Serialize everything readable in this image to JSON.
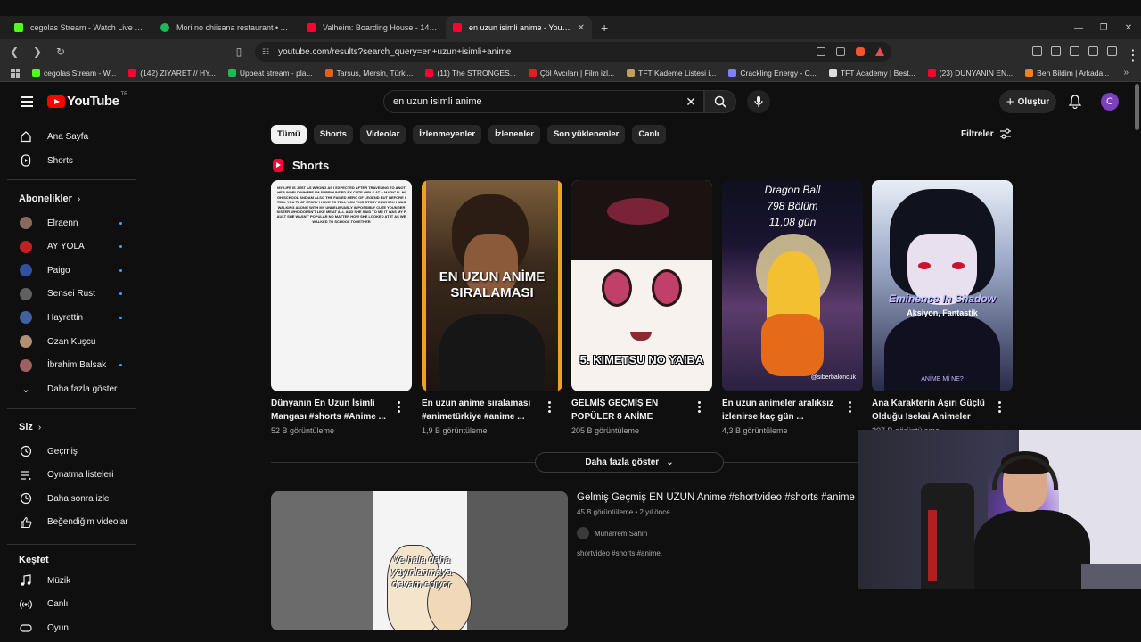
{
  "browser": {
    "tabs": [
      {
        "title": "cegolas Stream - Watch Live on Kick",
        "color": "#53fc18"
      },
      {
        "title": "Mori no chiisana restaurant • Aoi Te",
        "color": "#1db954"
      },
      {
        "title": "Valheim: Boarding House - 14 Player",
        "color": "#ff0033"
      },
      {
        "title": "en uzun isimli anime - YouTube",
        "color": "#ff0033",
        "active": true
      }
    ],
    "url": "youtube.com/results?search_query=en+uzun+isimli+anime",
    "bookmarks": [
      {
        "label": "cegolas Stream - W...",
        "color": "#53fc18"
      },
      {
        "label": "(142) ZİYARET // HY...",
        "color": "#ff0033"
      },
      {
        "label": "Upbeat stream - pla...",
        "color": "#1db954"
      },
      {
        "label": "Tarsus, Mersin, Türki...",
        "color": "#e06020"
      },
      {
        "label": "(11) The STRONGES...",
        "color": "#ff0033"
      },
      {
        "label": "Çöl Avcıları | Film izl...",
        "color": "#e02020"
      },
      {
        "label": "TFT Kademe Listesi i...",
        "color": "#c0a060"
      },
      {
        "label": "Crackling Energy - C...",
        "color": "#8080ff"
      },
      {
        "label": "TFT Academy | Best...",
        "color": "#dddddd"
      },
      {
        "label": "(23) DÜNYANIN EN...",
        "color": "#ff0033"
      },
      {
        "label": "Ben Bildim | Arkada...",
        "color": "#f08030"
      }
    ]
  },
  "youtube": {
    "logo_text": "YouTube",
    "region": "TR",
    "search_value": "en uzun isimli anime",
    "create_label": "Oluştur",
    "avatar_letter": "C",
    "sidebar": {
      "main": [
        {
          "label": "Ana Sayfa",
          "icon": "home-icon"
        },
        {
          "label": "Shorts",
          "icon": "shorts-icon"
        }
      ],
      "subscriptions_header": "Abonelikler",
      "subscriptions": [
        {
          "label": "Elraenn",
          "color": "#8a6a5a",
          "dot": true
        },
        {
          "label": "AY YOLA",
          "color": "#c02020",
          "dot": true
        },
        {
          "label": "Paigo",
          "color": "#3050a0",
          "dot": true
        },
        {
          "label": "Sensei Rust",
          "color": "#606060",
          "dot": true
        },
        {
          "label": "Hayrettin",
          "color": "#4060a0",
          "dot": true
        },
        {
          "label": "Ozan Kuşcu",
          "color": "#b09070",
          "dot": false
        },
        {
          "label": "İbrahim Balsak",
          "color": "#a06060",
          "dot": true
        }
      ],
      "show_more": "Daha fazla göster",
      "you_header": "Siz",
      "you": [
        {
          "label": "Geçmiş",
          "icon": "history-icon"
        },
        {
          "label": "Oynatma listeleri",
          "icon": "playlist-icon"
        },
        {
          "label": "Daha sonra izle",
          "icon": "clock-icon"
        },
        {
          "label": "Beğendiğim videolar",
          "icon": "thumbs-up-icon"
        }
      ],
      "explore_header": "Keşfet",
      "explore": [
        {
          "label": "Müzik",
          "icon": "music-icon"
        },
        {
          "label": "Canlı",
          "icon": "live-icon"
        },
        {
          "label": "Oyun",
          "icon": "game-icon"
        }
      ]
    },
    "chips": [
      "Tümü",
      "Shorts",
      "Videolar",
      "İzlenmeyenler",
      "İzlenenler",
      "Son yüklenenler",
      "Canlı"
    ],
    "filters_label": "Filtreler",
    "shorts_heading": "Shorts",
    "shorts": [
      {
        "title": "Dünyanın En Uzun İsimli Mangası #shorts #Anime ...",
        "views": "52 B görüntüleme"
      },
      {
        "title": "En uzun anime sıralaması #animetürkiye #anime ...",
        "views": "1,9 B görüntüleme",
        "overlay": "EN UZUN ANİME SIRALAMASI"
      },
      {
        "title": "GELMİŞ GEÇMİŞ EN POPÜLER 8 ANİME",
        "views": "205 B görüntüleme",
        "overlay": "5. KIMETSU NO YAIBA"
      },
      {
        "title": "En uzun animeler aralıksız izlenirse kaç gün ...",
        "views": "4,3 B görüntüleme",
        "overlay": [
          "Dragon Ball",
          "798 Bölüm",
          "11,08 gün"
        ],
        "handle": "@siberbaloncuk"
      },
      {
        "title": "Ana Karakterin Aşırı Güçlü Olduğu Isekai Animeler",
        "views": "207 B görüntüleme",
        "overlay": [
          "Eminence In Shadow",
          "Aksiyon, Fantastik",
          "ANİME Mİ NE?"
        ]
      }
    ],
    "shorts_text_block": "MY LIFE IS JUST AS WRONG AS I EXPECTED AFTER TRAVELING TO ANOTHER WORLD WHERE I'M SURROUNDED BY CUTE GIRLS AT A MAGICAL HIGH SCHOOL AND AM ALSO THE FAILED HERO OF LEGEND BUT BEFORE I TELL YOU THAT STORY I HAVE TO TELL YOU THIS STORY IN WHICH I WAS WALKING ALONG WITH MY UNBELIEVABLY IMPOSSIBLY CUTE YOUNGER SISTER WHO DOESN'T LIKE ME AT ALL AND SHE SAID TO ME IT WAS MY FAULT SHE WASN'T POPULAR NO MATTER HOW SHE LOOKED AT IT AS WE WALKED TO SCHOOL TOGETHER",
    "show_more_btn": "Daha fazla göster",
    "video": {
      "title": "Gelmiş Geçmiş EN UZUN Anime #shortvideo #shorts #anime",
      "meta": "45 B görüntüleme • 2 yıl önce",
      "channel": "Muharrem Sahin",
      "desc": "shortvideo #shorts #anime.",
      "overlay": "Ve hala daha yayınlanmaya devam ediyor"
    }
  }
}
